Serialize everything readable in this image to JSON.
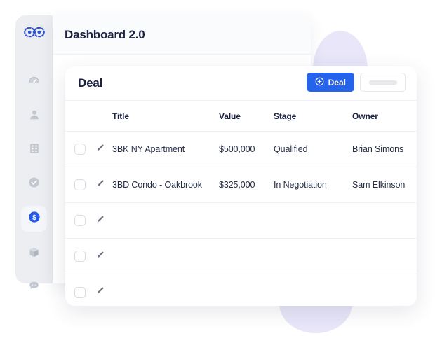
{
  "window": {
    "title": "Dashboard 2.0"
  },
  "sidebar": {
    "logo_icon": "chain-link-logo-icon",
    "items": [
      {
        "icon": "gauge-icon",
        "name": "dashboard",
        "active": false
      },
      {
        "icon": "person-icon",
        "name": "contacts",
        "active": false
      },
      {
        "icon": "building-grid-icon",
        "name": "companies",
        "active": false
      },
      {
        "icon": "check-circle-icon",
        "name": "tasks",
        "active": false
      },
      {
        "icon": "dollar-circle-icon",
        "name": "deals",
        "active": true
      },
      {
        "icon": "box-cube-icon",
        "name": "products",
        "active": false
      },
      {
        "icon": "chat-bubble-icon",
        "name": "messages",
        "active": false
      }
    ]
  },
  "card": {
    "title": "Deal",
    "add_button": {
      "label": "Deal",
      "icon": "plus-circle-icon"
    },
    "secondary_button": {
      "label": ""
    },
    "columns": [
      "Title",
      "Value",
      "Stage",
      "Owner"
    ],
    "rows": [
      {
        "title": "3BK NY Apartment",
        "value": "$500,000",
        "stage": "Qualified",
        "owner": "Brian Simons",
        "placeholder": false
      },
      {
        "title": "3BD Condo - Oakbrook",
        "value": "$325,000",
        "stage": "In Negotiation",
        "owner": "Sam Elkinson",
        "placeholder": false
      },
      {
        "title": "",
        "value": "",
        "stage": "",
        "owner": "",
        "placeholder": true
      },
      {
        "title": "",
        "value": "",
        "stage": "",
        "owner": "",
        "placeholder": true
      },
      {
        "title": "",
        "value": "",
        "stage": "",
        "owner": "",
        "placeholder": true
      }
    ]
  },
  "colors": {
    "accent_blue": "#2563eb",
    "sidebar_bg": "#eceef2",
    "blob_lavender": "#e8e6f8",
    "text_dark": "#1b2140",
    "skeleton_gray": "#eceef1"
  }
}
